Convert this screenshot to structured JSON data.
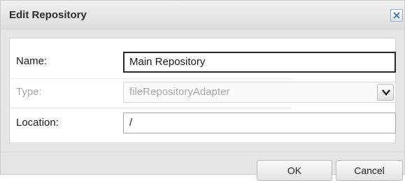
{
  "dialog": {
    "title": "Edit Repository",
    "close_icon": "close-x-icon"
  },
  "form": {
    "name": {
      "label": "Name:",
      "value": "Main Repository"
    },
    "type": {
      "label": "Type:",
      "value": "fileRepositoryAdapter",
      "enabled": false,
      "arrow_icon": "chevron-down-icon"
    },
    "location": {
      "label": "Location:",
      "value": "/"
    }
  },
  "buttons": {
    "ok": "OK",
    "cancel": "Cancel"
  },
  "colors": {
    "background": "#e6e6e6",
    "panel": "#ffffff",
    "disabled_text": "#a8a8a8",
    "close_accent": "#3a6ea5"
  }
}
